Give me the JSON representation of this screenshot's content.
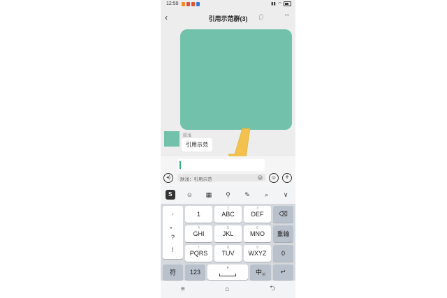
{
  "status_bar": {
    "time": "12:59"
  },
  "header": {
    "back_icon": "‹",
    "title": "引用示范群(3)",
    "more_icon": "···"
  },
  "chat": {
    "messages": [
      {
        "type": "image",
        "color": "#72c1aa"
      },
      {
        "type": "text",
        "sender": "肤浅",
        "text": "引用示范",
        "avatar_color": "#72c1aa"
      }
    ]
  },
  "input": {
    "quote_text": "肤浅：引用示范",
    "voice_icon": "voice-icon",
    "emoji_icon": "emoji-icon",
    "plus_icon": "plus-icon"
  },
  "ime_toolbar": {
    "sogou_label": "S",
    "items": [
      "emoji-icon",
      "keyboard-icon",
      "mic-icon",
      "handwriting-icon",
      "search-icon",
      "chevron-down-icon"
    ],
    "glyphs": [
      "☺",
      "▦",
      "⚲",
      "✎",
      "⌕",
      "∨"
    ]
  },
  "keyboard": {
    "punct": [
      ",",
      "。",
      "?",
      "!"
    ],
    "row1": [
      {
        "label": "1",
        "sup": ""
      },
      {
        "label": "ABC",
        "sup": "2"
      },
      {
        "label": "DEF",
        "sup": "3"
      }
    ],
    "row2": [
      {
        "label": "GHI",
        "sup": "4"
      },
      {
        "label": "JKL",
        "sup": "5"
      },
      {
        "label": "MNO",
        "sup": "6"
      }
    ],
    "row3": [
      {
        "label": "PQRS",
        "sup": "7"
      },
      {
        "label": "TUV",
        "sup": "8"
      },
      {
        "label": "WXYZ",
        "sup": "9"
      }
    ],
    "delete_label": "⌫",
    "retype_label": "重输",
    "zero_label": "0",
    "symbol_label": "符",
    "num_label": "123",
    "space_label": "",
    "lang_label": "中",
    "lang_sub": "英",
    "enter_label": "↵"
  },
  "nav": {
    "menu_icon": "≡",
    "home_icon": "⌂",
    "back_icon": "⮌"
  },
  "annotation": {
    "arrow_color": "#f2c14e"
  }
}
